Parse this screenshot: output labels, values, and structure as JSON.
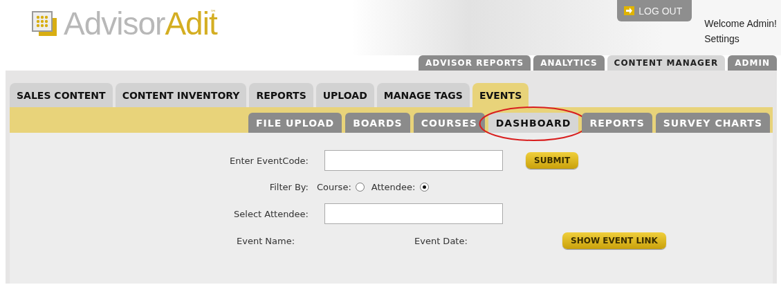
{
  "logo": {
    "part_1": "Advisor",
    "part_2": "Adit",
    "mark": "™"
  },
  "logout": {
    "label": "LOG OUT"
  },
  "welcome": "Welcome Admin!",
  "settings": "Settings",
  "top_tabs": [
    {
      "label": "ADVISOR REPORTS",
      "selected": false
    },
    {
      "label": "ANALYTICS",
      "selected": false
    },
    {
      "label": "CONTENT MANAGER",
      "selected": true
    },
    {
      "label": "ADMIN",
      "selected": false
    }
  ],
  "section_tabs": [
    {
      "label": "SALES CONTENT",
      "selected": false
    },
    {
      "label": "CONTENT INVENTORY",
      "selected": false
    },
    {
      "label": "REPORTS",
      "selected": false
    },
    {
      "label": "UPLOAD",
      "selected": false
    },
    {
      "label": "MANAGE TAGS",
      "selected": false
    },
    {
      "label": "EVENTS",
      "selected": true
    }
  ],
  "sub_tabs": [
    {
      "label": "FILE UPLOAD",
      "selected": false,
      "circled": false
    },
    {
      "label": "BOARDS",
      "selected": false,
      "circled": false
    },
    {
      "label": "COURSES",
      "selected": false,
      "circled": false
    },
    {
      "label": "DASHBOARD",
      "selected": true,
      "circled": true
    },
    {
      "label": "REPORTS",
      "selected": false,
      "circled": false
    },
    {
      "label": "SURVEY CHARTS",
      "selected": false,
      "circled": false
    }
  ],
  "form": {
    "event_code_label": "Enter EventCode:",
    "submit": "SUBMIT",
    "filter_label": "Filter By:",
    "filter_options": [
      {
        "label": "Course:",
        "selected": false
      },
      {
        "label": "Attendee:",
        "selected": true
      }
    ],
    "attendee_label": "Select Attendee:",
    "event_name_label": "Event Name:",
    "event_date_label": "Event Date:",
    "show_link": "SHOW EVENT LINK"
  }
}
